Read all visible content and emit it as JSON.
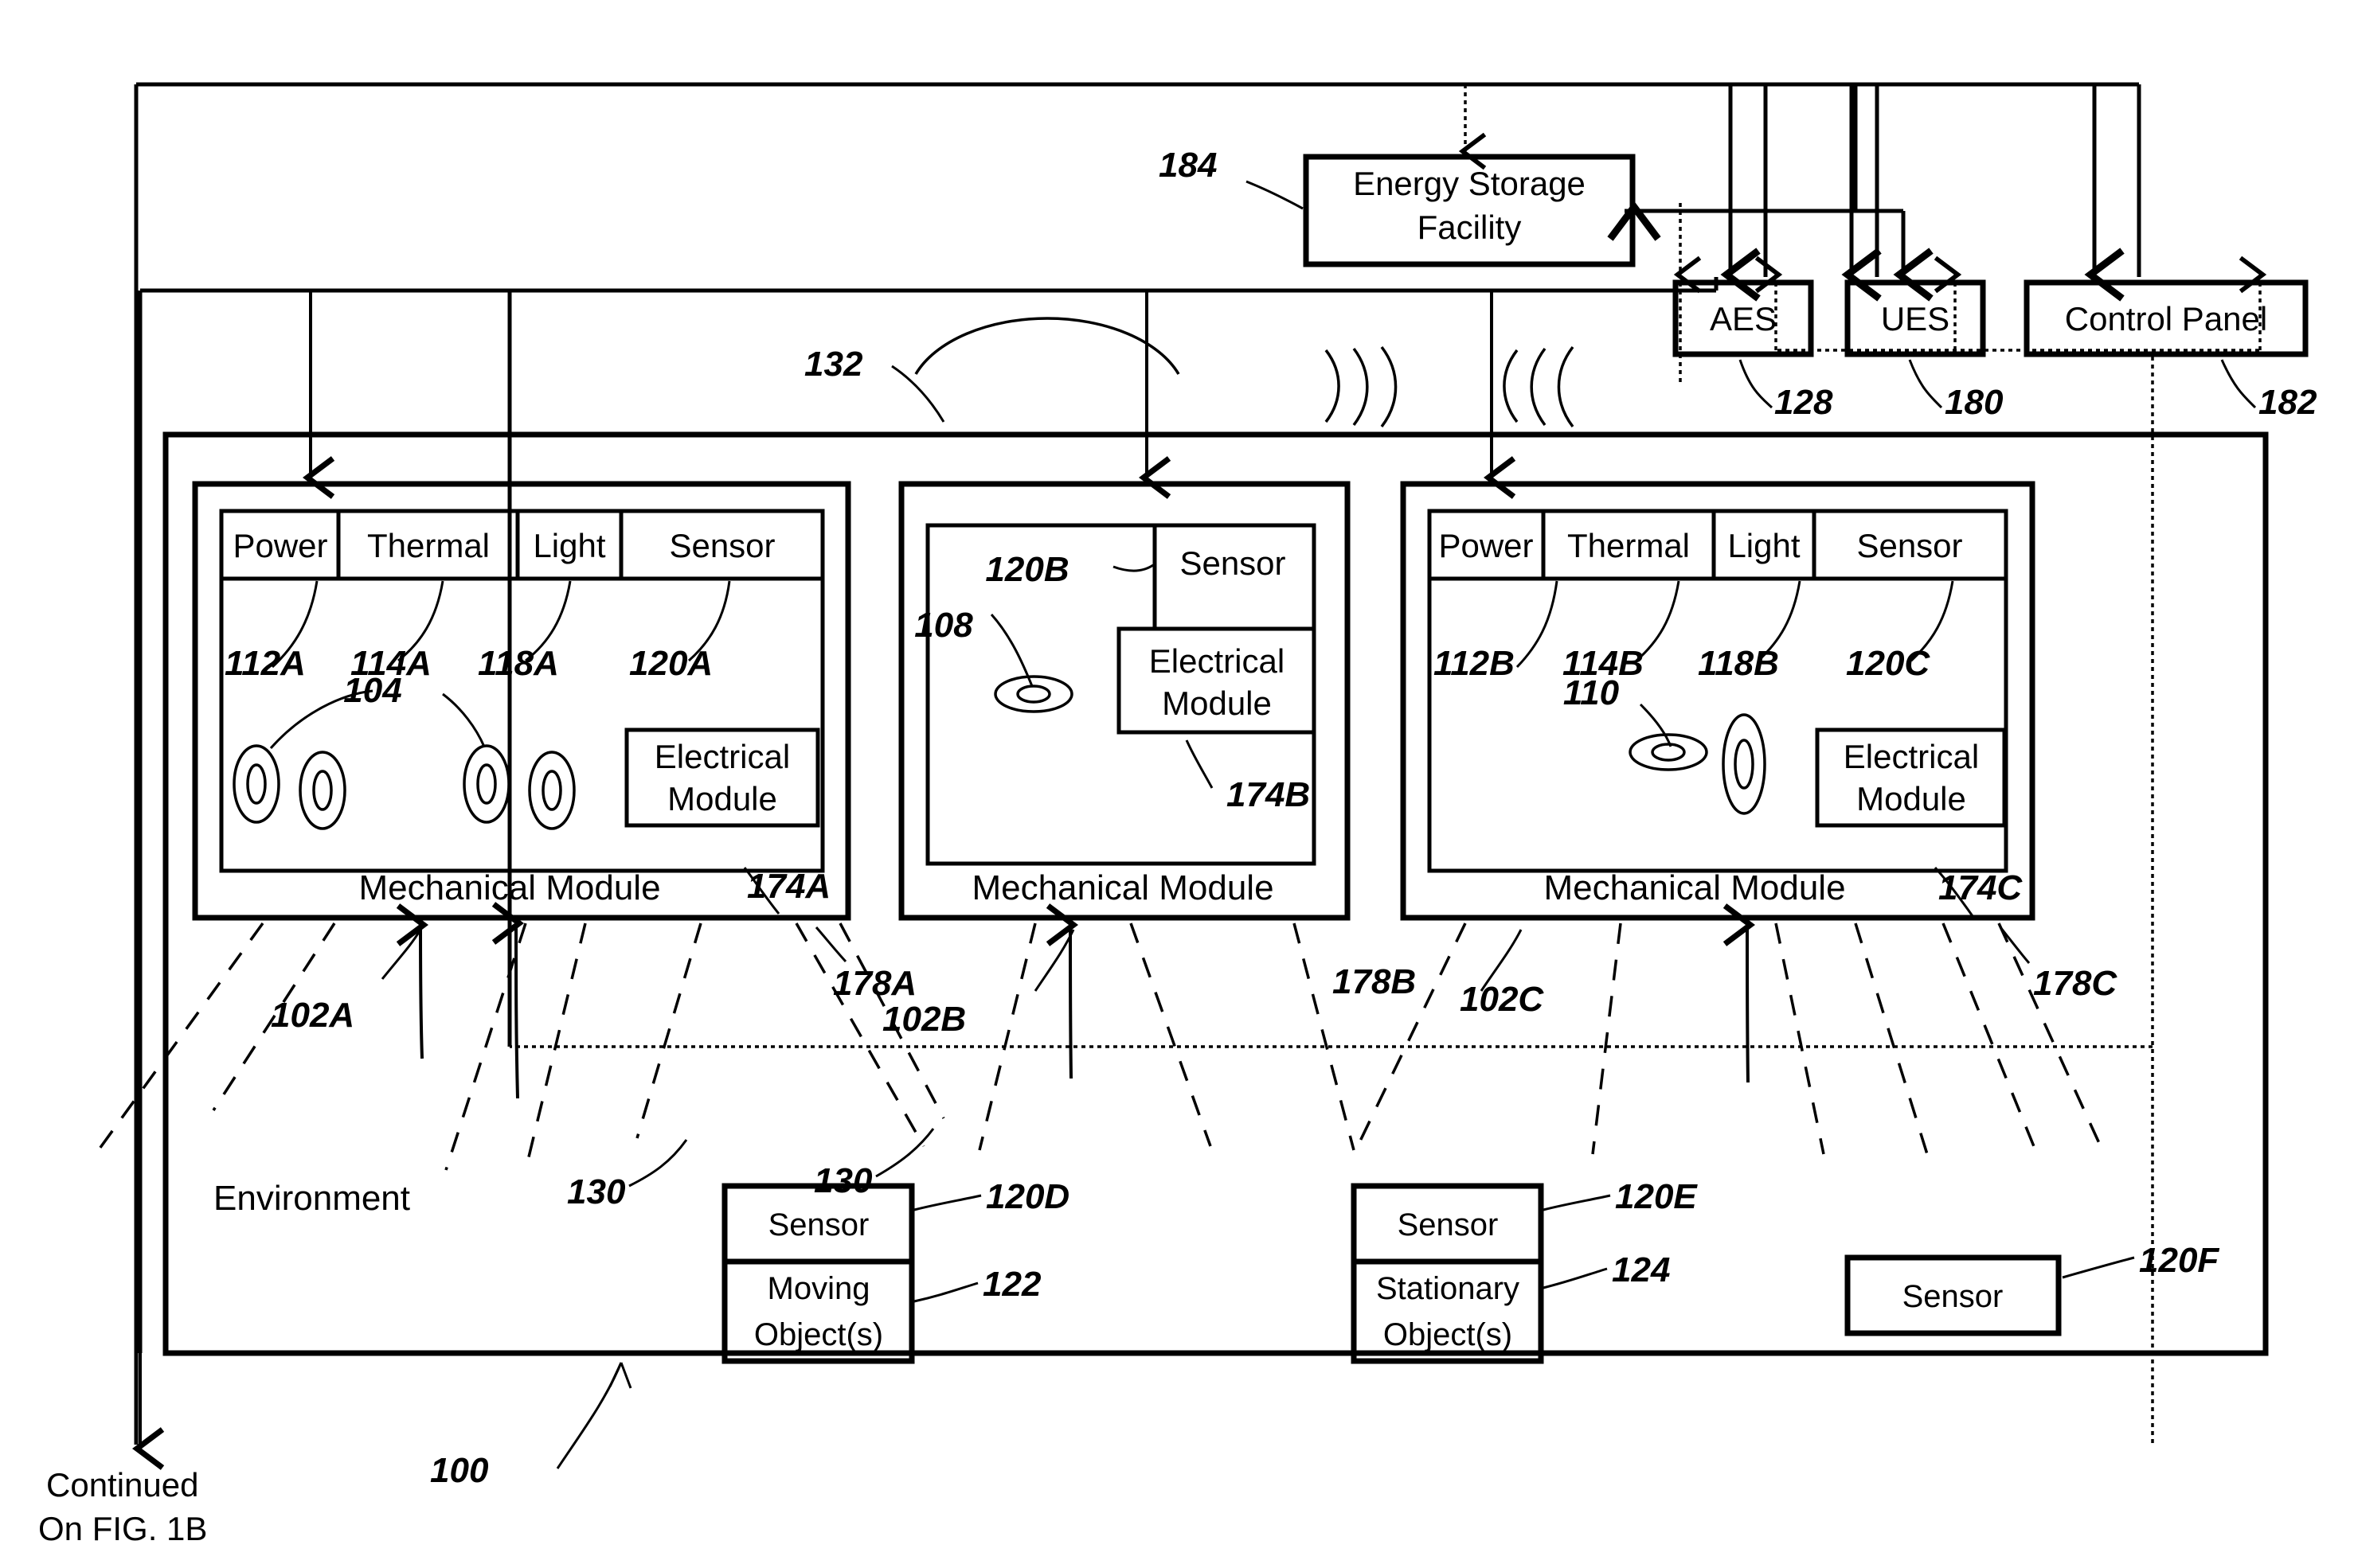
{
  "figure": {
    "title": "",
    "continuation_note_line1": "Continued",
    "continuation_note_line2": "On  FIG.  1B",
    "system_ref": "100",
    "environment_label": "Environment"
  },
  "top_boxes": {
    "energy_storage": {
      "line1": "Energy Storage",
      "line2": "Facility",
      "ref": "184"
    },
    "aes": {
      "label": "AES",
      "ref": "128"
    },
    "ues": {
      "label": "UES",
      "ref": "180"
    },
    "control_panel": {
      "label": "Control Panel",
      "ref": "182"
    }
  },
  "wireless": {
    "ref": "132"
  },
  "modules": [
    {
      "name": "module-a",
      "mechanical_label": "Mechanical  Module",
      "mechanical_ref": "102A",
      "electrical_label_line1": "Electrical",
      "electrical_label_line2": "Module",
      "electrical_ref": "174A",
      "module_outer_ref": "178A",
      "subsystems": [
        {
          "label": "Power",
          "ref": "112A"
        },
        {
          "label": "Thermal",
          "ref": "114A"
        },
        {
          "label": "Light",
          "ref": "118A"
        },
        {
          "label": "Sensor",
          "ref": "120A"
        }
      ],
      "element_ref": "104",
      "element_count": 4
    },
    {
      "name": "module-b",
      "mechanical_label": "Mechanical  Module",
      "mechanical_ref": "102B",
      "electrical_label_line1": "Electrical",
      "electrical_label_line2": "Module",
      "electrical_ref": "174B",
      "module_outer_ref": "178B",
      "subsystems": [
        {
          "label": "Sensor",
          "ref": "120B"
        }
      ],
      "element_ref": "108",
      "element_count": 1
    },
    {
      "name": "module-c",
      "mechanical_label": "Mechanical  Module",
      "mechanical_ref": "102C",
      "electrical_label_line1": "Electrical",
      "electrical_label_line2": "Module",
      "electrical_ref": "174C",
      "module_outer_ref": "178C",
      "subsystems": [
        {
          "label": "Power",
          "ref": "112B"
        },
        {
          "label": "Thermal",
          "ref": "114B"
        },
        {
          "label": "Light",
          "ref": "118B"
        },
        {
          "label": "Sensor",
          "ref": "120C"
        }
      ],
      "element_ref": "110",
      "element_count": 2
    }
  ],
  "environment_items": [
    {
      "name": "moving-objects",
      "sensor_label": "Sensor",
      "sensor_ref": "120D",
      "object_line1": "Moving",
      "object_line2": "Object(s)",
      "object_ref": "122"
    },
    {
      "name": "stationary-objects",
      "sensor_label": "Sensor",
      "sensor_ref": "120E",
      "object_line1": "Stationary",
      "object_line2": "Object(s)",
      "object_ref": "124"
    },
    {
      "name": "standalone-sensor",
      "sensor_label": "Sensor",
      "sensor_ref": "120F"
    }
  ],
  "interaction_refs": {
    "first": "130",
    "second": "130"
  },
  "colors": {
    "ink": "#000000",
    "paper": "#ffffff"
  }
}
